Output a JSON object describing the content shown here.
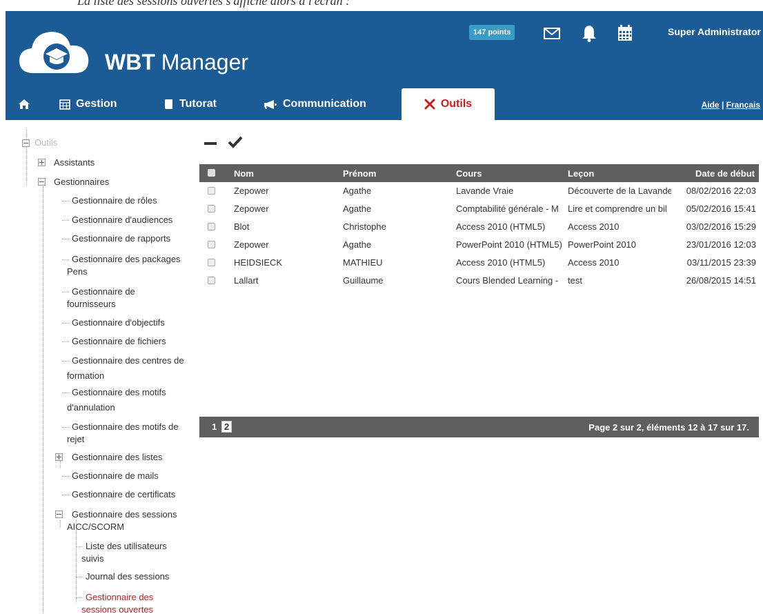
{
  "caption": "La liste des sessions ouvertes s'affiche alors à l'écran :",
  "header": {
    "brand_bold": "WBT",
    "brand_rest": "Manager",
    "points": "147 points",
    "user": "Super Administrator",
    "brand_color": "#1b5c96"
  },
  "nav": {
    "tabs": [
      {
        "label": ""
      },
      {
        "label": "Gestion"
      },
      {
        "label": "Tutorat"
      },
      {
        "label": "Communication"
      },
      {
        "label": "Outils"
      }
    ],
    "help": "Aide",
    "separator": "|",
    "language": "Français",
    "active_color": "#cc1a1a"
  },
  "tree": {
    "root": "Outils",
    "assistants": "Assistants",
    "gestionnaires": "Gestionnaires",
    "items": [
      "Gestionnaire de rôles",
      "Gestionnaire d'audiences",
      "Gestionnaire de rapports",
      "Gestionnaire des packages",
      "Pens",
      "Gestionnaire de",
      "fournisseurs",
      "Gestionnaire d'objectifs",
      "Gestionnaire de fichiers",
      "Gestionnaire des centres de",
      "formation",
      "Gestionnaire des motifs",
      "d'annulation",
      "Gestionnaire des motifs de",
      "rejet",
      "Gestionnaire des listes",
      "Gestionnaire de mails",
      "Gestionnaire de certificats",
      "Gestionnaire des sessions",
      "AICC/SCORM"
    ],
    "sub": [
      "Liste des utilisateurs",
      "suivis",
      "Journal des sessions",
      "Gestionnaire des",
      "sessions ouvertes"
    ]
  },
  "grid": {
    "columns": [
      "Nom",
      "Prénom",
      "Cours",
      "Leçon",
      "Date de début"
    ],
    "rows": [
      [
        "Zepower",
        "Agathe",
        "Lavande Vraie",
        "Découverte de la Lavande",
        "08/02/2016 22:03"
      ],
      [
        "Zepower",
        "Agathe",
        "Comptabilité générale - M",
        "Lire et comprendre un bil",
        "05/02/2016 15:41"
      ],
      [
        "Blot",
        "Christophe",
        "Access 2010 (HTML5)",
        "Access 2010",
        "03/02/2016 15:29"
      ],
      [
        "Zepower",
        "Agathe",
        "PowerPoint 2010 (HTML5)",
        "PowerPoint 2010",
        "23/01/2016 12:03"
      ],
      [
        "HEIDSIECK",
        "MATHIEU",
        "Access 2010 (HTML5)",
        "Access 2010",
        "03/11/2015 23:39"
      ],
      [
        "Lallart",
        "Guillaume",
        "Cours Blended Learning -",
        "test",
        "26/08/2015 14:51"
      ]
    ]
  },
  "pager": {
    "page1": "1",
    "page2": "2",
    "info": "Page 2 sur 2, éléments 12 à 17 sur 17."
  }
}
